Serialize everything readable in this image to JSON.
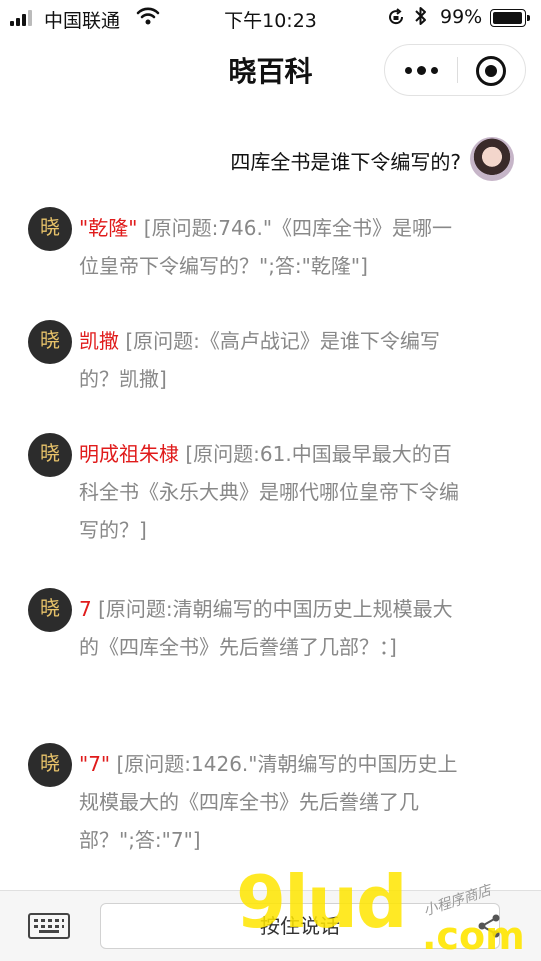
{
  "status_bar": {
    "carrier": "中国联通",
    "time": "下午10:23",
    "battery_pct": "99%",
    "battery_level": 0.99
  },
  "nav": {
    "title": "晓百科"
  },
  "conversation": {
    "user_question": "四库全书是谁下令编写的?",
    "bot_avatar_char": "晓",
    "replies": [
      {
        "answer": "\"乾隆\"",
        "detail": "[原问题:746.\"《四库全书》是哪一位皇帝下令编写的？\";答:\"乾隆\"]"
      },
      {
        "answer": "凯撒",
        "detail": "[原问题:《高卢战记》是谁下令编写的？凯撒]"
      },
      {
        "answer": "明成祖朱棣",
        "detail": "[原问题:61.中国最早最大的百科全书《永乐大典》是哪代哪位皇帝下令编写的？]"
      },
      {
        "answer": "7",
        "detail": "[原问题:清朝编写的中国历史上规模最大的《四库全书》先后誊缮了几部？：]"
      },
      {
        "answer": "\"7\"",
        "detail": "[原问题:1426.\"清朝编写的中国历史上规模最大的《四库全书》先后誊缮了几部？\";答:\"7\"]"
      }
    ]
  },
  "bottom_bar": {
    "voice_button": "按住说话"
  },
  "watermark": {
    "main": "9lud",
    "domain": ".com",
    "tagline": "小程序商店"
  }
}
